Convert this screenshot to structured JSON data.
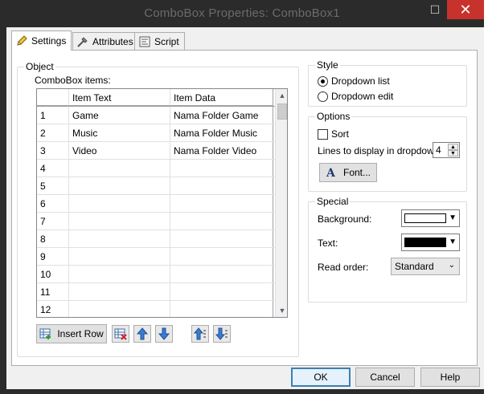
{
  "window": {
    "title": "ComboBox Properties: ComboBox1"
  },
  "titlebar": {
    "minimize": "—",
    "maximize": "☐",
    "close": "✕"
  },
  "tabs": [
    {
      "label": "Settings",
      "icon": "pencil-icon"
    },
    {
      "label": "Attributes",
      "icon": "tools-icon"
    },
    {
      "label": "Script",
      "icon": "script-icon"
    }
  ],
  "object_group": {
    "label": "Object",
    "items_label": "ComboBox items:"
  },
  "grid": {
    "headers": [
      "",
      "Item Text",
      "Item Data"
    ],
    "rows": [
      [
        "1",
        "Game",
        "Nama Folder Game"
      ],
      [
        "2",
        "Music",
        "Nama Folder Music"
      ],
      [
        "3",
        "Video",
        "Nama Folder Video"
      ],
      [
        "4",
        "",
        ""
      ],
      [
        "5",
        "",
        ""
      ],
      [
        "6",
        "",
        ""
      ],
      [
        "7",
        "",
        ""
      ],
      [
        "8",
        "",
        ""
      ],
      [
        "9",
        "",
        ""
      ],
      [
        "10",
        "",
        ""
      ],
      [
        "11",
        "",
        ""
      ],
      [
        "12",
        "",
        ""
      ]
    ]
  },
  "grid_buttons": {
    "insert_row": "Insert Row"
  },
  "style_group": {
    "label": "Style",
    "dropdown_list": "Dropdown list",
    "dropdown_edit": "Dropdown edit",
    "selected": "dropdown_list"
  },
  "options_group": {
    "label": "Options",
    "sort": "Sort",
    "sort_checked": false,
    "lines_label": "Lines to display in dropdown:",
    "lines_value": "4",
    "font_button": "Font..."
  },
  "special_group": {
    "label": "Special",
    "background_label": "Background:",
    "background_color": "#ffffff",
    "text_label": "Text:",
    "text_color": "#000000",
    "read_order_label": "Read order:",
    "read_order_value": "Standard"
  },
  "footer": {
    "ok": "OK",
    "cancel": "Cancel",
    "help": "Help"
  }
}
